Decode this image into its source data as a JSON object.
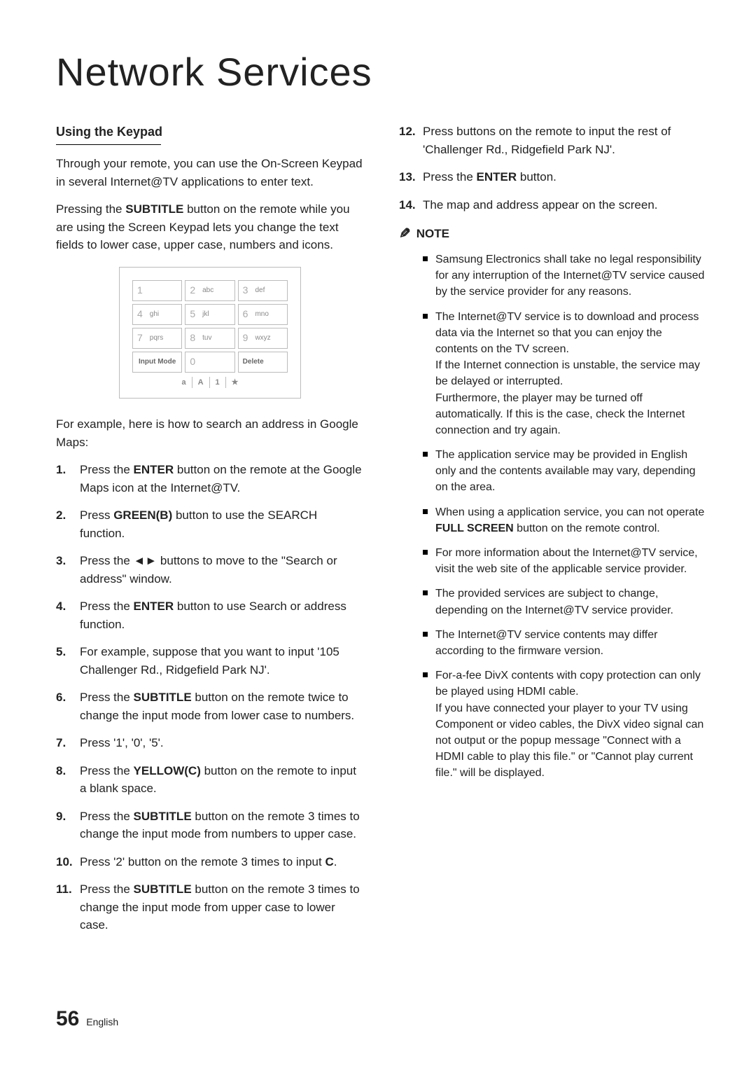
{
  "title": "Network Services",
  "left": {
    "subhead": "Using the Keypad",
    "p1": "Through your remote, you can use the On-Screen Keypad in several Internet@TV applications to enter text.",
    "p2a": "Pressing the ",
    "p2b": "SUBTITLE",
    "p2c": " button on the remote while you are using the Screen Keypad lets you change the text fields to lower case, upper case, numbers and icons.",
    "p3": "For example, here is how to search an address in Google Maps:",
    "s1a": "Press the ",
    "s1b": "ENTER",
    "s1c": " button on the remote at the Google Maps icon at the Internet@TV.",
    "s2a": "Press ",
    "s2b": "GREEN(B)",
    "s2c": " button to use the SEARCH function.",
    "s3a": "Press the ",
    "s3arrows": "◄►",
    "s3b": " buttons to move to the \"Search or address\" window.",
    "s4a": "Press the ",
    "s4b": "ENTER",
    "s4c": " button to use Search or address function.",
    "s5": "For example, suppose that you want to input '105 Challenger Rd., Ridgefield Park NJ'.",
    "s6a": "Press the ",
    "s6b": "SUBTITLE",
    "s6c": " button on the remote twice to change the input mode from lower case to numbers.",
    "s7": "Press '1', '0', '5'.",
    "s8a": "Press the ",
    "s8b": "YELLOW(C)",
    "s8c": " button on the remote to input a blank space.",
    "s9a": "Press the ",
    "s9b": "SUBTITLE",
    "s9c": " button on the remote 3 times to change the input mode from numbers to upper case.",
    "s10a": "Press '2' button on the remote 3 times to input ",
    "s10b": "C",
    "s10c": ".",
    "s11a": "Press the ",
    "s11b": "SUBTITLE",
    "s11c": " button on the remote 3 times to change the input mode from upper case to lower case."
  },
  "right": {
    "s12": "Press buttons on the remote to input the rest of 'Challenger Rd., Ridgefield Park NJ'.",
    "s13a": "Press the ",
    "s13b": "ENTER",
    "s13c": " button.",
    "s14": "The map and address appear on the screen.",
    "note_label": "NOTE",
    "n1": "Samsung Electronics shall take no legal responsibility for any interruption of the Internet@TV service caused by the service provider for any reasons.",
    "n2": "The Internet@TV service is to download and process data via the Internet so that you can enjoy the contents on the TV screen.\nIf the Internet connection is unstable, the service may be delayed or interrupted.\nFurthermore, the player may be turned off automatically. If this is the case, check the Internet connection and try again.",
    "n3": "The application service may be provided in English only and the contents available may vary, depending on the area.",
    "n4a": "When using a application service, you can not operate ",
    "n4b": "FULL SCREEN",
    "n4c": " button on the remote control.",
    "n5": "For more information about the Internet@TV service, visit the web site of the applicable service provider.",
    "n6": "The provided services are subject to change, depending on the Internet@TV service provider.",
    "n7": "The Internet@TV service contents may differ according to the firmware version.",
    "n8": "For-a-fee DivX contents with copy protection can only be played using HDMI cable.\nIf you have connected your player to your TV using Component or video cables, the DivX video signal can not output or the popup message \"Connect with a HDMI cable to play this file.\" or \"Cannot play current file.\" will be displayed."
  },
  "keypad": {
    "k1n": "1",
    "k1l": "",
    "k2n": "2",
    "k2l": "abc",
    "k3n": "3",
    "k3l": "def",
    "k4n": "4",
    "k4l": "ghi",
    "k5n": "5",
    "k5l": "jkl",
    "k6n": "6",
    "k6l": "mno",
    "k7n": "7",
    "k7l": "pqrs",
    "k8n": "8",
    "k8l": "tuv",
    "k9n": "9",
    "k9l": "wxyz",
    "inputmode": "Input Mode",
    "k0n": "0",
    "delete": "Delete",
    "m1": "a",
    "m2": "A",
    "m3": "1",
    "m4": "★"
  },
  "footer": {
    "page": "56",
    "lang": "English"
  }
}
